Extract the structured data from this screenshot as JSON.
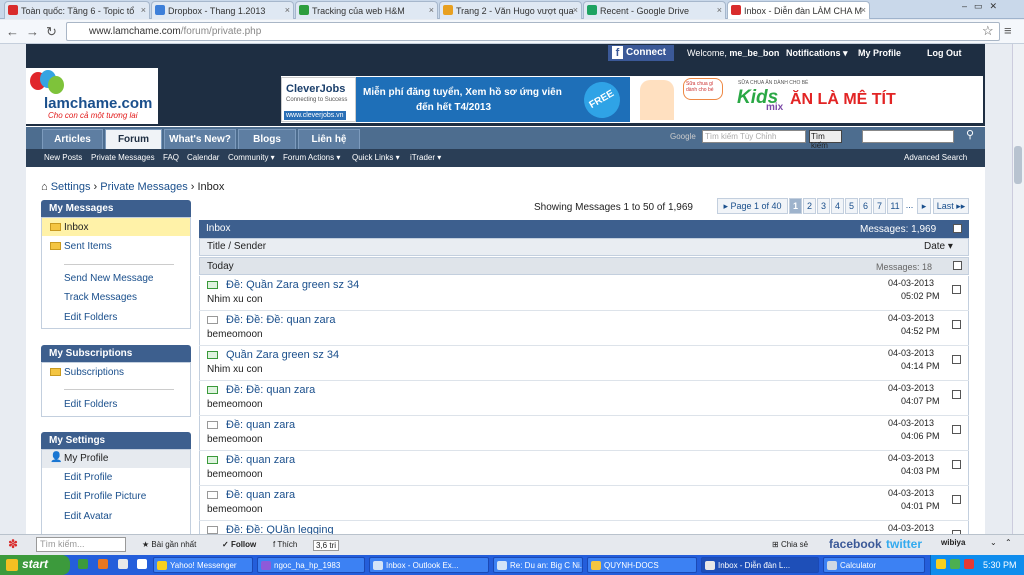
{
  "browser": {
    "tabs": [
      {
        "label": "Toàn quốc: Tầng 6 - Topic tổ",
        "color": "#d92c2c"
      },
      {
        "label": "Dropbox - Thang 1.2013",
        "color": "#3d7fd9"
      },
      {
        "label": "Tracking của web H&M",
        "color": "#2e9e3e"
      },
      {
        "label": "Trang 2 - Văn Hugo vượt qua",
        "color": "#e8a020"
      },
      {
        "label": "Recent - Google Drive",
        "color": "#1ea362"
      },
      {
        "label": "Inbox - Diễn đàn LÀM CHA M",
        "color": "#d92c2c"
      }
    ],
    "url_host": "www.lamchame.com",
    "url_path": "/forum/private.php"
  },
  "forum": {
    "fb_connect": "Connect",
    "welcome_prefix": "Welcome,",
    "username": "me_be_bon",
    "notifications": "Notifications ▾",
    "my_profile": "My Profile",
    "logout": "Log Out",
    "logo_text": "lamchame.com",
    "logo_tagline": "Cho con cả một tương lai",
    "ads": {
      "cleverjobs": "CleverJobs",
      "cleverjobs_tag": "Connecting to Success",
      "cleverjobs_url": "www.cleverjobs.vn",
      "promo_line1": "Miễn phí đăng tuyển, Xem hồ sơ ứng viên",
      "promo_line2": "đến hết T4/2013",
      "free": "FREE",
      "speech": "Sữa chua gì dành cho bé",
      "kids": "Kids",
      "kids_mix": "mix",
      "kids_slogan": "ĂN LÀ MÊ TÍT",
      "kids_small": "SỮA CHUA ĂN DÀNH CHO BÉ"
    },
    "nav_tabs": [
      "Articles",
      "Forum",
      "What's New?",
      "Blogs",
      "Liên hệ"
    ],
    "google_label": "Google",
    "google_placeholder": "Tìm kiếm Tùy Chỉnh",
    "google_button": "Tìm kiếm",
    "sub_links": [
      "New Posts",
      "Private Messages",
      "FAQ",
      "Calendar",
      "Community ▾",
      "Forum Actions ▾",
      "Quick Links ▾",
      "iTrader ▾"
    ],
    "advanced_search": "Advanced Search",
    "breadcrumb": {
      "settings": "Settings",
      "pm": "Private Messages",
      "current": "Inbox"
    }
  },
  "sidebar": {
    "my_messages_title": "My Messages",
    "inbox": "Inbox",
    "sent": "Sent Items",
    "send_new": "Send New Message",
    "track": "Track Messages",
    "edit_folders": "Edit Folders",
    "subs_title": "My Subscriptions",
    "subscriptions": "Subscriptions",
    "subs_edit_folders": "Edit Folders",
    "settings_title": "My Settings",
    "my_profile": "My Profile",
    "edit_profile": "Edit Profile",
    "edit_picture": "Edit Profile Picture",
    "edit_avatar": "Edit Avatar"
  },
  "main": {
    "showing": "Showing Messages 1 to 50 of 1,969",
    "page_label": "▸ Page 1 of 40",
    "pages": [
      "1",
      "2",
      "3",
      "4",
      "5",
      "6",
      "7",
      "11",
      "..."
    ],
    "next": "▸",
    "last": "Last ▸▸",
    "inbox_title": "Inbox",
    "messages_count": "Messages: 1,969",
    "col_title": "Title / Sender",
    "col_date": "Date ▾",
    "group_today": "Today",
    "today_count": "Messages: 18",
    "messages": [
      {
        "title": "Đề: Quần Zara green sz 34",
        "sender": "Nhim xu con",
        "date": "04-03-2013",
        "time": "05:02 PM",
        "new": true
      },
      {
        "title": "Đề: Đề: Đề: quan zara",
        "sender": "bemeomoon",
        "date": "04-03-2013",
        "time": "04:52 PM",
        "new": false
      },
      {
        "title": "Quần Zara green sz 34",
        "sender": "Nhim xu con",
        "date": "04-03-2013",
        "time": "04:14 PM",
        "new": true
      },
      {
        "title": "Đề: Đề: quan zara",
        "sender": "bemeomoon",
        "date": "04-03-2013",
        "time": "04:07 PM",
        "new": true
      },
      {
        "title": "Đề: quan zara",
        "sender": "bemeomoon",
        "date": "04-03-2013",
        "time": "04:06 PM",
        "new": false
      },
      {
        "title": "Đề: quan zara",
        "sender": "bemeomoon",
        "date": "04-03-2013",
        "time": "04:03 PM",
        "new": true
      },
      {
        "title": "Đề: quan zara",
        "sender": "bemeomoon",
        "date": "04-03-2013",
        "time": "04:01 PM",
        "new": false
      },
      {
        "title": "Đề: Đề: QUần legging",
        "sender": "",
        "date": "04-03-2013",
        "time": "",
        "new": false
      }
    ]
  },
  "toolbar": {
    "search_placeholder": "Tìm kiếm...",
    "recent": "Bài gần nhất",
    "follow": "Follow",
    "like": "Thích",
    "like_count": "3,6 tri",
    "share": "Chia sẻ",
    "facebook": "facebook",
    "twitter": "twitter",
    "wibiya": "wibiya"
  },
  "taskbar": {
    "start": "start",
    "tasks": [
      "Yahoo! Messenger",
      "ngoc_ha_hp_1983",
      "Inbox - Outlook Ex...",
      "Re: Du an: Big C Ni...",
      "QUYNH-DOCS",
      "Inbox - Diễn đàn L...",
      "Calculator"
    ],
    "clock": "5:30 PM"
  }
}
